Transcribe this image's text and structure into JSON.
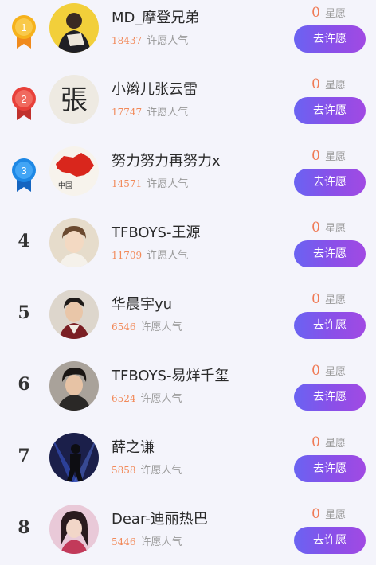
{
  "colors": {
    "background": "#f4f4fb",
    "popularity_number": "#f28a5a",
    "stars_number": "#f07a55",
    "muted_text": "#9a9a9a",
    "button_gradient_start": "#6a63f2",
    "button_gradient_end": "#a14ae3",
    "medal_gold": "#f6b21c",
    "medal_red": "#e8403a",
    "medal_blue": "#1e88e5"
  },
  "rows": [
    {
      "rank": "1",
      "rank_style": "gold-medal",
      "name": "MD_摩登兄弟",
      "popularity": "18437",
      "popularity_label": "许愿人气",
      "stars": "0",
      "stars_label": "星愿",
      "button_label": "去许愿",
      "avatar_icon": "person-avatar-icon"
    },
    {
      "rank": "2",
      "rank_style": "red-medal",
      "name": "小辫儿张云雷",
      "popularity": "17747",
      "popularity_label": "许愿人气",
      "stars": "0",
      "stars_label": "星愿",
      "button_label": "去许愿",
      "avatar_icon": "calligraphy-avatar-icon",
      "avatar_text": "張"
    },
    {
      "rank": "3",
      "rank_style": "blue-medal",
      "name": "努力努力再努力x",
      "popularity": "14571",
      "popularity_label": "许愿人气",
      "stars": "0",
      "stars_label": "星愿",
      "button_label": "去许愿",
      "avatar_icon": "china-map-avatar-icon",
      "avatar_text": "中国"
    },
    {
      "rank": "4",
      "rank_style": "number",
      "name": "TFBOYS-王源",
      "popularity": "11709",
      "popularity_label": "许愿人气",
      "stars": "0",
      "stars_label": "星愿",
      "button_label": "去许愿",
      "avatar_icon": "person-avatar-icon"
    },
    {
      "rank": "5",
      "rank_style": "number",
      "name": "华晨宇yu",
      "popularity": "6546",
      "popularity_label": "许愿人气",
      "stars": "0",
      "stars_label": "星愿",
      "button_label": "去许愿",
      "avatar_icon": "person-avatar-icon"
    },
    {
      "rank": "6",
      "rank_style": "number",
      "name": "TFBOYS-易烊千玺",
      "popularity": "6524",
      "popularity_label": "许愿人气",
      "stars": "0",
      "stars_label": "星愿",
      "button_label": "去许愿",
      "avatar_icon": "person-avatar-icon"
    },
    {
      "rank": "7",
      "rank_style": "number",
      "name": "薛之谦",
      "popularity": "5858",
      "popularity_label": "许愿人气",
      "stars": "0",
      "stars_label": "星愿",
      "button_label": "去许愿",
      "avatar_icon": "stage-performer-avatar-icon"
    },
    {
      "rank": "8",
      "rank_style": "number",
      "name": "Dear-迪丽热巴",
      "popularity": "5446",
      "popularity_label": "许愿人气",
      "stars": "0",
      "stars_label": "星愿",
      "button_label": "去许愿",
      "avatar_icon": "person-avatar-icon"
    }
  ]
}
